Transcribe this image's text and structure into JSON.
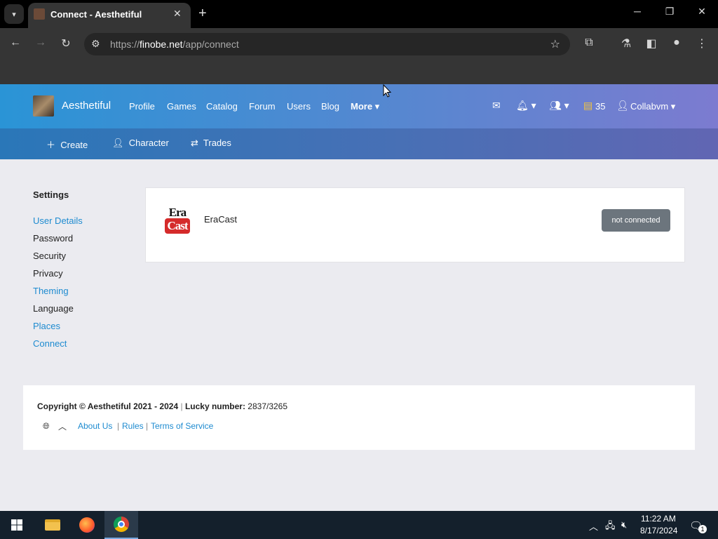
{
  "browser": {
    "tab_title": "Connect - Aesthetiful",
    "url_scheme": "https://",
    "url_host": "finobe.net",
    "url_path": "/app/connect"
  },
  "site": {
    "brand": "Aesthetiful",
    "nav": [
      "Profile",
      "Games",
      "Catalog",
      "Forum",
      "Users",
      "Blog",
      "More"
    ],
    "currency_count": "35",
    "username": "Collabvm",
    "subnav": [
      "Create",
      "Character",
      "Trades"
    ]
  },
  "settings": {
    "title": "Settings",
    "items": [
      {
        "label": "User Details",
        "link": true
      },
      {
        "label": "Password",
        "link": false
      },
      {
        "label": "Security",
        "link": false
      },
      {
        "label": "Privacy",
        "link": false
      },
      {
        "label": "Theming",
        "link": true
      },
      {
        "label": "Language",
        "link": false
      },
      {
        "label": "Places",
        "link": true
      },
      {
        "label": "Connect",
        "link": true
      }
    ]
  },
  "connection": {
    "logo_top": "Era",
    "logo_bottom": "Cast",
    "service": "EraCast",
    "status": "not connected"
  },
  "footer": {
    "copyright_prefix": "Copyright © Aesthetiful 2021 - 2024",
    "lucky_label": "Lucky number:",
    "lucky_value": "2837/3265",
    "links": [
      "About Us",
      "Rules",
      "Terms of Service"
    ]
  },
  "taskbar": {
    "time": "11:22 AM",
    "date": "8/17/2024",
    "notification_count": "1"
  }
}
